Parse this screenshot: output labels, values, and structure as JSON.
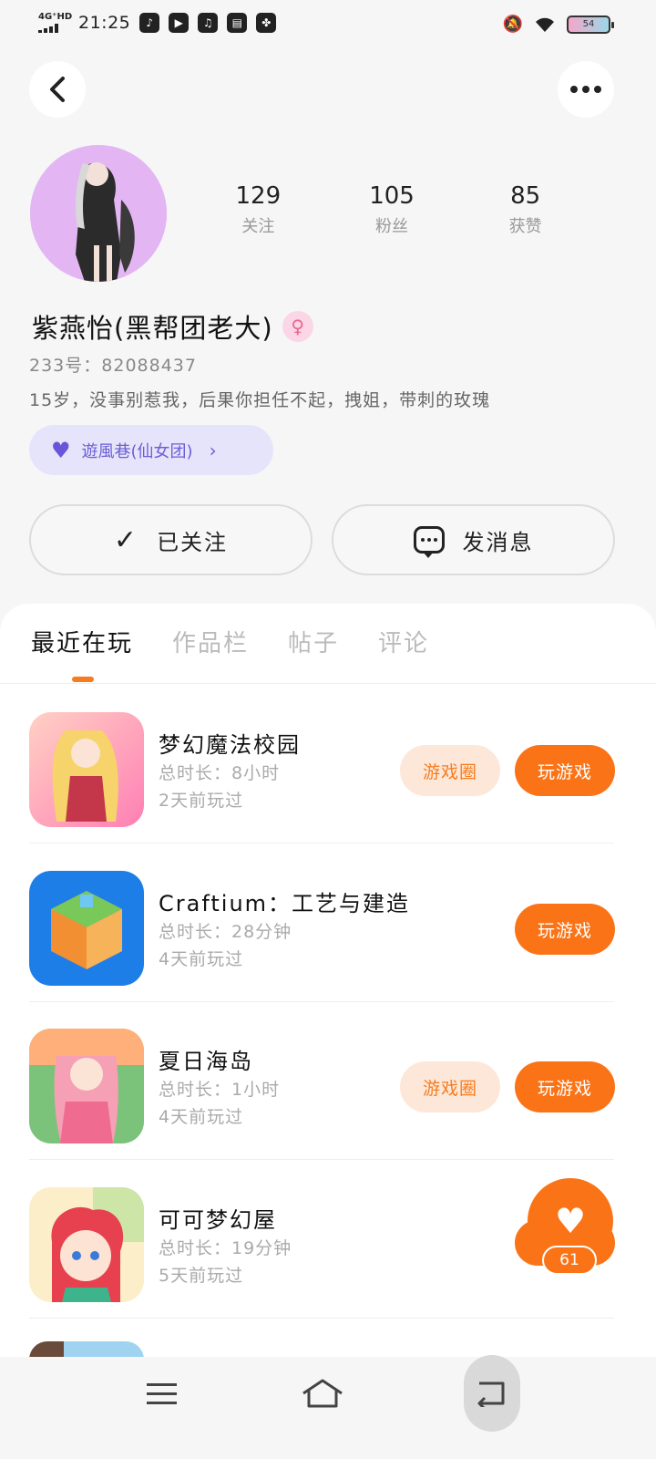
{
  "status_bar": {
    "network": "4G⁺HD",
    "time": "21:25",
    "battery": "54"
  },
  "profile": {
    "stats": [
      {
        "num": "129",
        "label": "关注"
      },
      {
        "num": "105",
        "label": "粉丝"
      },
      {
        "num": "85",
        "label": "获赞"
      }
    ],
    "username": "紫燕怡(黑帮团老大)",
    "gender_symbol": "♀",
    "uid": "233号：82088437",
    "bio": "15岁，没事别惹我，后果你担任不起，拽姐，带刺的玫瑰",
    "group": "遊風巷(仙女团)",
    "follow_label": "已关注",
    "message_label": "发消息"
  },
  "tabs": [
    {
      "label": "最近在玩",
      "active": true
    },
    {
      "label": "作品栏",
      "active": false
    },
    {
      "label": "帖子",
      "active": false
    },
    {
      "label": "评论",
      "active": false
    }
  ],
  "games": [
    {
      "title": "梦幻魔法校园",
      "duration": "总时长：8小时",
      "last": "2天前玩过",
      "circle": "游戏圈",
      "play": "玩游戏"
    },
    {
      "title": "Craftium：工艺与建造",
      "duration": "总时长：28分钟",
      "last": "4天前玩过",
      "play": "玩游戏"
    },
    {
      "title": "夏日海岛",
      "duration": "总时长：1小时",
      "last": "4天前玩过",
      "circle": "游戏圈",
      "play": "玩游戏"
    },
    {
      "title": "可可梦幻屋",
      "duration": "总时长：19分钟",
      "last": "5天前玩过"
    }
  ],
  "fab": {
    "count": "61"
  },
  "colors": {
    "accent": "#fa7417",
    "accent_light": "#fde7d8",
    "group_bg": "#e6e4fa",
    "group_text": "#6b5fd6"
  }
}
